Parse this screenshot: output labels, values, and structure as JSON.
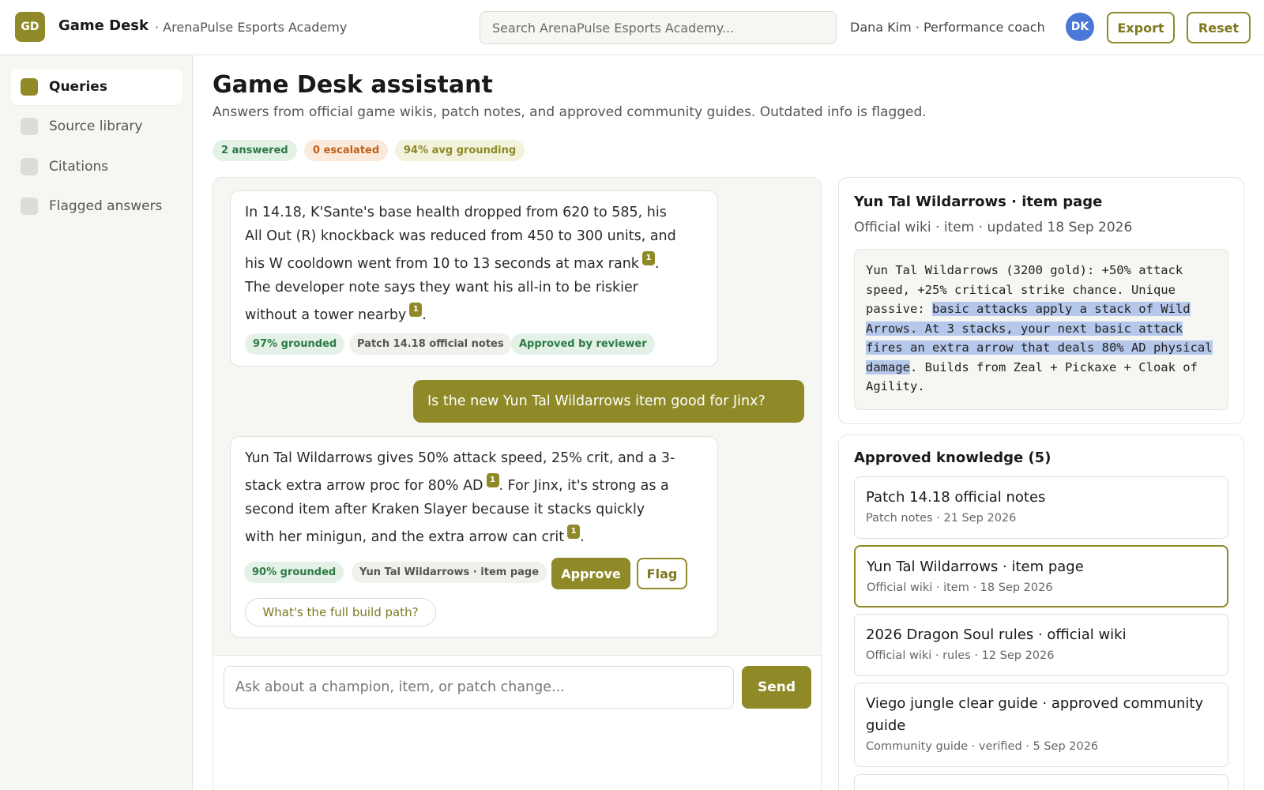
{
  "app": {
    "logo_initials": "GD",
    "name": "Game Desk",
    "org": "· ArenaPulse Esports Academy",
    "search_placeholder": "Search ArenaPulse Esports Academy...",
    "user": "Dana Kim · Performance coach",
    "avatar_initials": "DK",
    "export_label": "Export",
    "reset_label": "Reset"
  },
  "sidebar": {
    "items": [
      {
        "label": "Queries",
        "active": true
      },
      {
        "label": "Source library",
        "active": false
      },
      {
        "label": "Citations",
        "active": false
      },
      {
        "label": "Flagged answers",
        "active": false
      }
    ]
  },
  "main": {
    "title": "Game Desk assistant",
    "subtitle": "Answers from official game wikis, patch notes, and approved community guides. Outdated info is flagged.",
    "stats": {
      "answered": "2 answered",
      "escalated": "0 escalated",
      "grounding": "94% avg grounding"
    }
  },
  "chat": {
    "answer1": {
      "line1": "In 14.18, K'Sante's base health dropped from 620 to 585, his",
      "line2": "All Out (R) knockback was reduced from 450 to 300 units, and",
      "line3": "his W cooldown went from 10 to 13 seconds at max rank",
      "line4": "The developer note says they want his all-in to be riskier",
      "line5": "without a tower nearby",
      "cite": "1",
      "period": ".",
      "grounded": "97% grounded",
      "source": "Patch 14.18 official notes",
      "status": "Approved by reviewer"
    },
    "question": "Is the new Yun Tal Wildarrows item good for Jinx?",
    "answer2": {
      "line1": "Yun Tal Wildarrows gives 50% attack speed, 25% crit, and a 3-",
      "line2a": "stack extra arrow proc for 80% AD",
      "line2b": ". For Jinx, it's strong as a",
      "line3": "second item after Kraken Slayer because it stacks quickly",
      "line4": "with her minigun, and the extra arrow can crit",
      "cite": "1",
      "period": ".",
      "grounded": "90% grounded",
      "source": "Yun Tal Wildarrows · item page",
      "approve_label": "Approve",
      "flag_label": "Flag",
      "suggestion": "What's the full build path?"
    },
    "composer_placeholder": "Ask about a champion, item, or patch change...",
    "send_label": "Send"
  },
  "detail": {
    "title": "Yun Tal Wildarrows · item page",
    "meta": "Official wiki · item · updated 18 Sep 2026",
    "excerpt_before": "Yun Tal Wildarrows (3200 gold): +50% attack speed, +25% critical strike chance. Unique passive: ",
    "excerpt_highlight": "basic attacks apply a stack of Wild Arrows. At 3 stacks, your next basic attack fires an extra arrow that deals 80% AD physical damage",
    "excerpt_after": ". Builds from Zeal + Pickaxe + Cloak of Agility."
  },
  "knowledge": {
    "title": "Approved knowledge (5)",
    "items": [
      {
        "title": "Patch 14.18 official notes",
        "meta": "Patch notes · 21 Sep 2026"
      },
      {
        "title": "Yun Tal Wildarrows · item page",
        "meta": "Official wiki · item · 18 Sep 2026"
      },
      {
        "title": "2026 Dragon Soul rules · official wiki",
        "meta": "Official wiki · rules · 12 Sep 2026"
      },
      {
        "title": "Viego jungle clear guide · approved community guide",
        "meta": "Community guide · verified · 5 Sep 2026"
      }
    ]
  },
  "colors": {
    "accent": "#8f8a27",
    "highlight": "#b5c7ea",
    "avatar": "#4a78d6"
  }
}
